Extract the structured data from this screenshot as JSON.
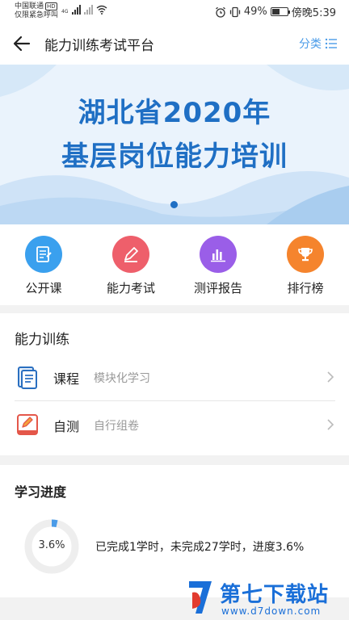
{
  "status_bar": {
    "carrier_line1": "中国联通",
    "carrier_badge": "HD",
    "carrier_line2": "仅限紧急呼叫",
    "net_4g": "4G",
    "battery_percent": "49%",
    "battery_level": 0.49,
    "time": "傍晚5:39"
  },
  "header": {
    "title": "能力训练考试平台",
    "category_label": "分类",
    "icons": {
      "back": "arrow-left-icon",
      "category": "list-icon"
    }
  },
  "banner": {
    "line1": "湖北省2020年",
    "line2": "基层岗位能力培训",
    "slide_count": 1,
    "active_slide": 0
  },
  "quick_menu": [
    {
      "label": "公开课",
      "icon": "document-icon",
      "color": "#3aa0ee"
    },
    {
      "label": "能力考试",
      "icon": "pen-icon",
      "color": "#ee5f6b"
    },
    {
      "label": "测评报告",
      "icon": "bar-chart-icon",
      "color": "#9a5ee8"
    },
    {
      "label": "排行榜",
      "icon": "trophy-icon",
      "color": "#f5842d"
    }
  ],
  "training": {
    "title": "能力训练",
    "items": [
      {
        "name": "课程",
        "desc": "模块化学习",
        "icon": "book-icon"
      },
      {
        "name": "自测",
        "desc": "自行组卷",
        "icon": "edit-icon"
      }
    ]
  },
  "progress": {
    "title": "学习进度",
    "percent_label": "3.6%",
    "percent": 3.6,
    "text": "已完成1学时，未完成27学时，进度3.6%"
  },
  "watermark": {
    "brand": "第七下载站",
    "url": "www.d7down.com"
  },
  "colors": {
    "accent": "#4a9be8",
    "banner_text": "#1f6fc4",
    "ring_fill": "#4a9be8",
    "ring_track": "#eeeeee"
  }
}
